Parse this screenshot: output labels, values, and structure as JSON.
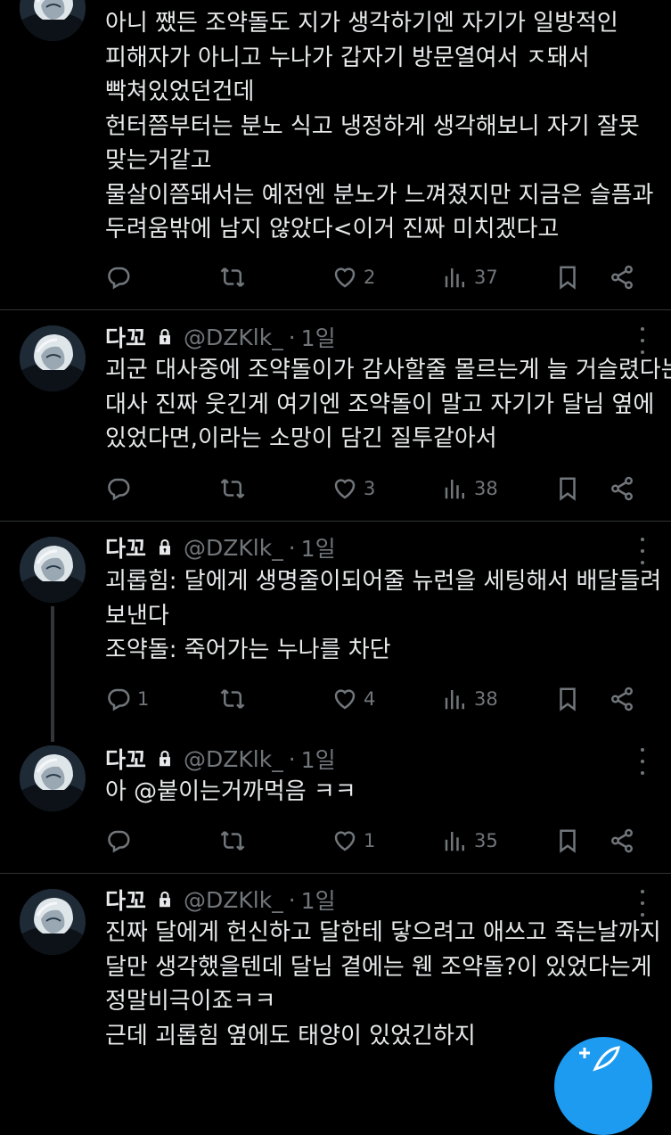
{
  "tweets": [
    {
      "name": "",
      "handle": "",
      "time": "",
      "lines": [
        "아니 쨌든 조약돌도 지가 생각하기엔 자기가 일방적인",
        "피해자가 아니고 누나가 갑자기 방문열여서 ㅈ돼서",
        "빡쳐있었던건데",
        "헌터쯤부터는 분노 식고 냉정하게 생각해보니 자기 잘못",
        "맞는거같고",
        "물살이쯤돼서는 예전엔 분노가 느껴졌지만 지금은 슬픔과",
        "두려움밖에 남지 않았다<이거 진짜 미치겠다고"
      ],
      "replies": "",
      "retweets": "",
      "likes": "2",
      "views": "37"
    },
    {
      "name": "다꼬",
      "handle": "@DZKlk_",
      "time": "1일",
      "lines": [
        "괴군 대사중에 조약돌이가 감사할줄 몰르는게 늘 거슬렸다는",
        "대사 진짜 웃긴게 여기엔 조약돌이 말고 자기가 달님 옆에",
        "있었다면,이라는 소망이 담긴 질투같아서"
      ],
      "replies": "",
      "retweets": "",
      "likes": "3",
      "views": "38"
    },
    {
      "name": "다꼬",
      "handle": "@DZKlk_",
      "time": "1일",
      "lines": [
        "괴롭힘: 달에게 생명줄이되어줄 뉴런을 세팅해서 배달들려",
        "보낸다",
        "조약돌: 죽어가는 누나를 차단"
      ],
      "replies": "1",
      "retweets": "",
      "likes": "4",
      "views": "38"
    },
    {
      "name": "다꼬",
      "handle": "@DZKlk_",
      "time": "1일",
      "lines": [
        "아 @붙이는거까먹음 ㅋㅋ"
      ],
      "replies": "",
      "retweets": "",
      "likes": "1",
      "views": "35"
    },
    {
      "name": "다꼬",
      "handle": "@DZKlk_",
      "time": "1일",
      "lines": [
        "진짜 달에게 헌신하고 달한테 닿으려고 애쓰고 죽는날까지",
        "달만 생각했을텐데 달님 곁에는 웬 조약돌?이 있었다는게",
        "정말비극이죠ㅋㅋ",
        "근데 괴롭힘 옆에도 태양이 있었긴하지"
      ]
    }
  ],
  "icons": {
    "reply": "reply-icon",
    "retweet": "retweet-icon",
    "like": "heart-icon",
    "views": "views-icon",
    "bookmark": "bookmark-icon",
    "share": "share-icon",
    "lock": "lock-icon",
    "compose": "compose-icon"
  },
  "colors": {
    "background": "#000000",
    "text": "#e7e9ea",
    "muted": "#71767b",
    "accent": "#1d9bf0",
    "divider": "#2f3336"
  }
}
